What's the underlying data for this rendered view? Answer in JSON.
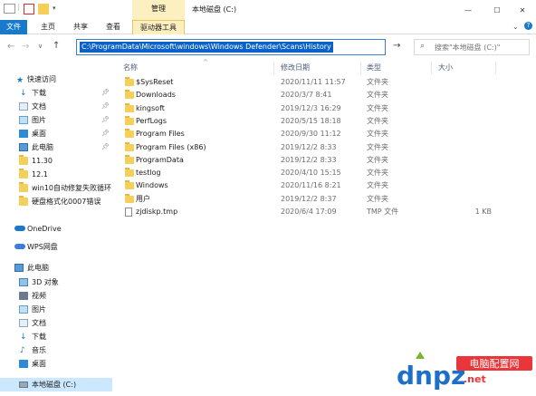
{
  "titlebar": {
    "manage_label": "管理",
    "path_title": "本地磁盘 (C:)",
    "minimize": "—",
    "maximize": "☐",
    "close": "✕"
  },
  "ribbon": {
    "tabs": [
      "文件",
      "主页",
      "共享",
      "查看"
    ],
    "context_tab": "驱动器工具"
  },
  "address": {
    "path": "C:\\ProgramData\\Microsoft\\windows\\Windows Defender\\Scans\\History",
    "search_placeholder": "搜索\"本地磁盘 (C:)\""
  },
  "nav": {
    "quick_access": "快速访问",
    "pinned": [
      {
        "label": "下载",
        "icon": "download-icon"
      },
      {
        "label": "文档",
        "icon": "documents-icon"
      },
      {
        "label": "图片",
        "icon": "pictures-icon"
      },
      {
        "label": "桌面",
        "icon": "desktop-icon"
      },
      {
        "label": "此电脑",
        "icon": "computer-icon"
      }
    ],
    "recent": [
      "11.30",
      "12.1",
      "win10自动修复失败循环",
      "硬盘格式化0007错误"
    ],
    "onedrive": "OneDrive",
    "wps": "WPS网盘",
    "this_pc": "此电脑",
    "pc_items": [
      {
        "label": "3D 对象",
        "icon": "3d-objects-icon"
      },
      {
        "label": "视频",
        "icon": "videos-icon"
      },
      {
        "label": "图片",
        "icon": "pictures-icon"
      },
      {
        "label": "文档",
        "icon": "documents-icon"
      },
      {
        "label": "下载",
        "icon": "download-icon"
      },
      {
        "label": "音乐",
        "icon": "music-icon"
      },
      {
        "label": "桌面",
        "icon": "desktop-icon"
      },
      {
        "label": "本地磁盘 (C:)",
        "icon": "drive-icon"
      }
    ]
  },
  "columns": {
    "name": "名称",
    "date": "修改日期",
    "type": "类型",
    "size": "大小"
  },
  "files": [
    {
      "name": "$SysReset",
      "date": "2020/11/11 11:57",
      "type": "文件夹",
      "size": "",
      "kind": "folder"
    },
    {
      "name": "Downloads",
      "date": "2020/3/7 8:41",
      "type": "文件夹",
      "size": "",
      "kind": "folder"
    },
    {
      "name": "kingsoft",
      "date": "2019/12/3 16:29",
      "type": "文件夹",
      "size": "",
      "kind": "folder"
    },
    {
      "name": "PerfLogs",
      "date": "2020/5/15 18:18",
      "type": "文件夹",
      "size": "",
      "kind": "folder"
    },
    {
      "name": "Program Files",
      "date": "2020/9/30 11:12",
      "type": "文件夹",
      "size": "",
      "kind": "folder"
    },
    {
      "name": "Program Files (x86)",
      "date": "2019/12/2 8:33",
      "type": "文件夹",
      "size": "",
      "kind": "folder"
    },
    {
      "name": "ProgramData",
      "date": "2019/12/2 8:33",
      "type": "文件夹",
      "size": "",
      "kind": "folder"
    },
    {
      "name": "testlog",
      "date": "2020/4/10 15:15",
      "type": "文件夹",
      "size": "",
      "kind": "folder"
    },
    {
      "name": "Windows",
      "date": "2020/11/16 8:21",
      "type": "文件夹",
      "size": "",
      "kind": "folder"
    },
    {
      "name": "用户",
      "date": "2019/12/2 8:37",
      "type": "文件夹",
      "size": "",
      "kind": "folder"
    },
    {
      "name": "zjdiskp.tmp",
      "date": "2020/6/4 17:09",
      "type": "TMP 文件",
      "size": "1 KB",
      "kind": "file"
    }
  ],
  "watermark": {
    "brand": "dnpz.net",
    "cn": "电脑配置网"
  },
  "colors": {
    "accent": "#1979ca",
    "folder": "#f4cf5a",
    "selection": "#cce8ff",
    "context_tab": "#fdf0c0"
  }
}
